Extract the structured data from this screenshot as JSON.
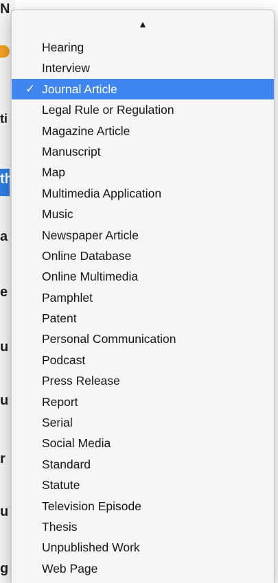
{
  "menu": {
    "scroll_up_glyph": "▲",
    "checkmark": "✓",
    "selected_index": 2,
    "items": [
      {
        "label": "Hearing"
      },
      {
        "label": "Interview"
      },
      {
        "label": "Journal Article"
      },
      {
        "label": "Legal Rule or Regulation"
      },
      {
        "label": "Magazine Article"
      },
      {
        "label": "Manuscript"
      },
      {
        "label": "Map"
      },
      {
        "label": "Multimedia Application"
      },
      {
        "label": "Music"
      },
      {
        "label": "Newspaper Article"
      },
      {
        "label": "Online Database"
      },
      {
        "label": "Online Multimedia"
      },
      {
        "label": "Pamphlet"
      },
      {
        "label": "Patent"
      },
      {
        "label": "Personal Communication"
      },
      {
        "label": "Podcast"
      },
      {
        "label": "Press Release"
      },
      {
        "label": "Report"
      },
      {
        "label": "Serial"
      },
      {
        "label": "Social Media"
      },
      {
        "label": "Standard"
      },
      {
        "label": "Statute"
      },
      {
        "label": "Television Episode"
      },
      {
        "label": "Thesis"
      },
      {
        "label": "Unpublished Work"
      },
      {
        "label": "Web Page"
      }
    ]
  },
  "background": {
    "fragments": [
      "N",
      "ti",
      "th",
      "a",
      "e",
      "u",
      "u",
      "r",
      "u",
      "g"
    ],
    "accent_color": "#f0a020",
    "link_color": "#2f7de1"
  },
  "colors": {
    "selection": "#3f86f0",
    "menu_bg": "#f6f6f6",
    "text": "#161616"
  }
}
